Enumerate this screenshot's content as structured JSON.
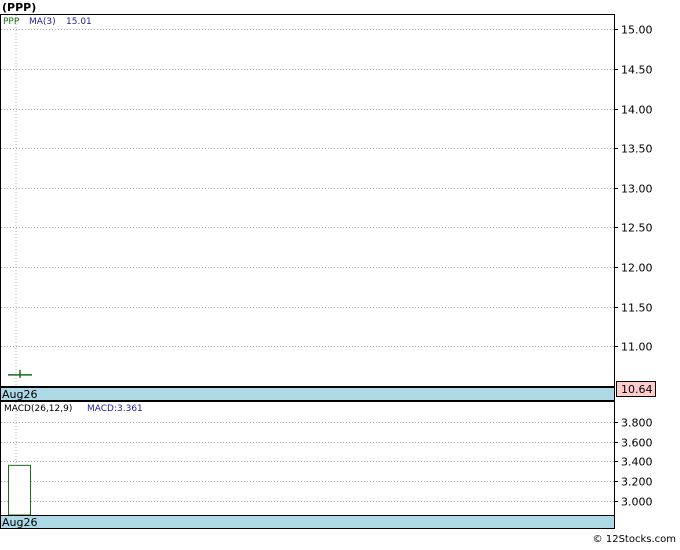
{
  "title": "(PPP)",
  "watermark": "© 12Stocks.com",
  "colors": {
    "price_tick": "#1a6b1a",
    "label_blue": "#1f1fa0",
    "axis_band": "#add8e6",
    "last_price_bg": "#ffcccc",
    "grid": "#b0b0b0",
    "macd_bar_edge": "#1a6b1a"
  },
  "price_panel": {
    "legend": {
      "symbol": "PPP",
      "ma_label": "MA(3)",
      "ma_value": "15.01"
    },
    "date_label": "Aug26",
    "last_price_label": "10.64"
  },
  "macd_panel": {
    "legend": {
      "params": "MACD(26,12,9)",
      "value_label": "MACD:3.361"
    },
    "date_label": "Aug26"
  },
  "chart_data": [
    {
      "type": "line",
      "panel": "price",
      "x": [
        "Aug26"
      ],
      "series": [
        {
          "name": "PPP",
          "values": [
            10.64
          ]
        },
        {
          "name": "MA(3)",
          "values": [
            15.01
          ]
        }
      ],
      "yticks": [
        11.0,
        11.5,
        12.0,
        12.5,
        13.0,
        13.5,
        14.0,
        14.5,
        15.0
      ],
      "ytick_labels": [
        "11.00",
        "11.50",
        "12.00",
        "12.50",
        "13.00",
        "13.50",
        "14.00",
        "14.50",
        "15.00"
      ],
      "ylim": [
        10.5,
        15.18
      ],
      "last_value": 10.64,
      "grid": true
    },
    {
      "type": "bar",
      "panel": "macd",
      "categories": [
        "Aug26"
      ],
      "series": [
        {
          "name": "MACD",
          "values": [
            3.361
          ]
        }
      ],
      "yticks": [
        3.0,
        3.2,
        3.4,
        3.6,
        3.8
      ],
      "ytick_labels": [
        "3.000",
        "3.200",
        "3.400",
        "3.600",
        "3.800"
      ],
      "ylim": [
        2.86,
        4.0
      ],
      "grid": true
    }
  ]
}
